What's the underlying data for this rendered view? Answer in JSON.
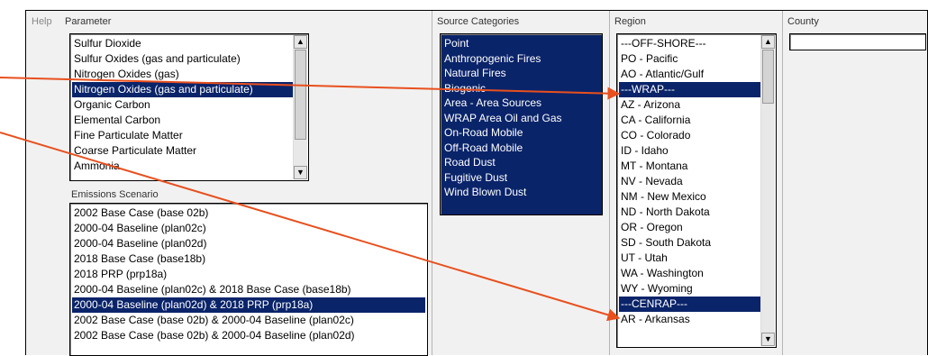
{
  "help_label": "Help",
  "parameter": {
    "label": "Parameter",
    "items": [
      {
        "label": "Sulfur Dioxide",
        "selected": false
      },
      {
        "label": "Sulfur Oxides (gas and particulate)",
        "selected": false
      },
      {
        "label": "Nitrogen Oxides (gas)",
        "selected": false
      },
      {
        "label": "Nitrogen Oxides (gas and particulate)",
        "selected": true
      },
      {
        "label": "Organic Carbon",
        "selected": false
      },
      {
        "label": "Elemental Carbon",
        "selected": false
      },
      {
        "label": "Fine Particulate Matter",
        "selected": false
      },
      {
        "label": "Coarse Particulate Matter",
        "selected": false
      },
      {
        "label": "Ammonia",
        "selected": false
      }
    ]
  },
  "scenario": {
    "label": "Emissions Scenario",
    "items": [
      {
        "label": "2002 Base Case (base 02b)",
        "selected": false
      },
      {
        "label": "2000-04 Baseline (plan02c)",
        "selected": false
      },
      {
        "label": "2000-04 Baseline (plan02d)",
        "selected": false
      },
      {
        "label": "2018 Base Case (base18b)",
        "selected": false
      },
      {
        "label": "2018 PRP (prp18a)",
        "selected": false
      },
      {
        "label": "2000-04 Baseline (plan02c) & 2018 Base Case (base18b)",
        "selected": false
      },
      {
        "label": "2000-04 Baseline (plan02d) & 2018 PRP (prp18a)",
        "selected": true
      },
      {
        "label": "2002 Base Case (base 02b) & 2000-04 Baseline (plan02c)",
        "selected": false
      },
      {
        "label": "2002 Base Case (base 02b) & 2000-04 Baseline (plan02d)",
        "selected": false
      }
    ]
  },
  "source": {
    "label": "Source Categories",
    "items": [
      {
        "label": "Point",
        "selected": true
      },
      {
        "label": "Anthropogenic Fires",
        "selected": true
      },
      {
        "label": "Natural Fires",
        "selected": true
      },
      {
        "label": "Biogenic",
        "selected": true
      },
      {
        "label": "Area - Area Sources",
        "selected": true
      },
      {
        "label": "WRAP Area Oil and Gas",
        "selected": true
      },
      {
        "label": "On-Road Mobile",
        "selected": true
      },
      {
        "label": "Off-Road Mobile",
        "selected": true
      },
      {
        "label": "Road Dust",
        "selected": true
      },
      {
        "label": "Fugitive Dust",
        "selected": true
      },
      {
        "label": "Wind Blown Dust",
        "selected": true
      }
    ]
  },
  "region": {
    "label": "Region",
    "items": [
      {
        "label": "---OFF-SHORE---",
        "selected": false
      },
      {
        "label": "PO - Pacific",
        "selected": false
      },
      {
        "label": "AO - Atlantic/Gulf",
        "selected": false
      },
      {
        "label": "---WRAP---",
        "selected": true
      },
      {
        "label": "AZ - Arizona",
        "selected": false
      },
      {
        "label": "CA - California",
        "selected": false
      },
      {
        "label": "CO - Colorado",
        "selected": false
      },
      {
        "label": "ID - Idaho",
        "selected": false
      },
      {
        "label": "MT - Montana",
        "selected": false
      },
      {
        "label": "NV - Nevada",
        "selected": false
      },
      {
        "label": "NM - New Mexico",
        "selected": false
      },
      {
        "label": "ND - North Dakota",
        "selected": false
      },
      {
        "label": "OR - Oregon",
        "selected": false
      },
      {
        "label": "SD - South Dakota",
        "selected": false
      },
      {
        "label": "UT - Utah",
        "selected": false
      },
      {
        "label": "WA - Washington",
        "selected": false
      },
      {
        "label": "WY - Wyoming",
        "selected": false
      },
      {
        "label": "---CENRAP---",
        "selected": true
      },
      {
        "label": "AR - Arkansas",
        "selected": false
      }
    ]
  },
  "county": {
    "label": "County",
    "value": ""
  },
  "colors": {
    "selection": "#0a246a",
    "arrow": "#e8501e",
    "panel": "#f1f1f1"
  }
}
